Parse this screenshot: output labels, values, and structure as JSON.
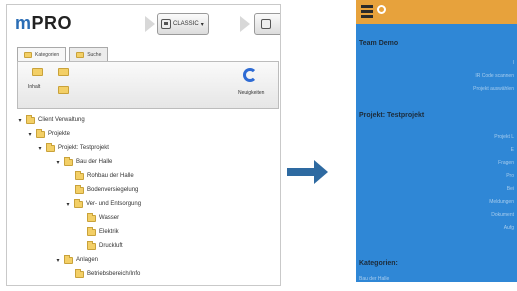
{
  "left_window": {
    "logo": "mPRO",
    "view_mode_label": "CLASSIC",
    "tabs": [
      {
        "label": "Kategorien"
      },
      {
        "label": "Suche"
      }
    ],
    "toolbar": {
      "left_label": "Inhalt",
      "right_label": "Neuigkeiten"
    },
    "tree": [
      {
        "label": "Client Verwaltung"
      },
      {
        "label": "Projekte"
      },
      {
        "label": "Projekt: Testprojekt"
      },
      {
        "label": "Bau der Halle"
      },
      {
        "label": "Rohbau der Halle"
      },
      {
        "label": "Bodenversiegelung"
      },
      {
        "label": "Ver- und Entsorgung"
      },
      {
        "label": "Wasser"
      },
      {
        "label": "Elektrik"
      },
      {
        "label": "Druckluft"
      },
      {
        "label": "Anlagen"
      },
      {
        "label": "Betriebsbereich/Info"
      }
    ]
  },
  "right_window": {
    "sections": [
      {
        "title": "Team Demo"
      },
      {
        "title": "Projekt: Testprojekt"
      },
      {
        "title": "Kategorien:"
      }
    ],
    "rows_team": [
      "I",
      "IR Code scannen",
      "Projekt auswählen"
    ],
    "rows_projekt": [
      "Projekt L",
      "E",
      "Fragen",
      "Pro",
      "Bei",
      "Meldungen",
      "Dokument",
      "Aufg"
    ],
    "rows_kategorien": [
      "Bau der Halle"
    ]
  },
  "colors": {
    "mobile_header": "#e7a23c",
    "mobile_body": "#2f87d6",
    "arrow": "#2e6aa1"
  },
  "icons": [
    "view-icon",
    "folder-icon",
    "refresh-icon",
    "menu-icon",
    "search-icon"
  ]
}
